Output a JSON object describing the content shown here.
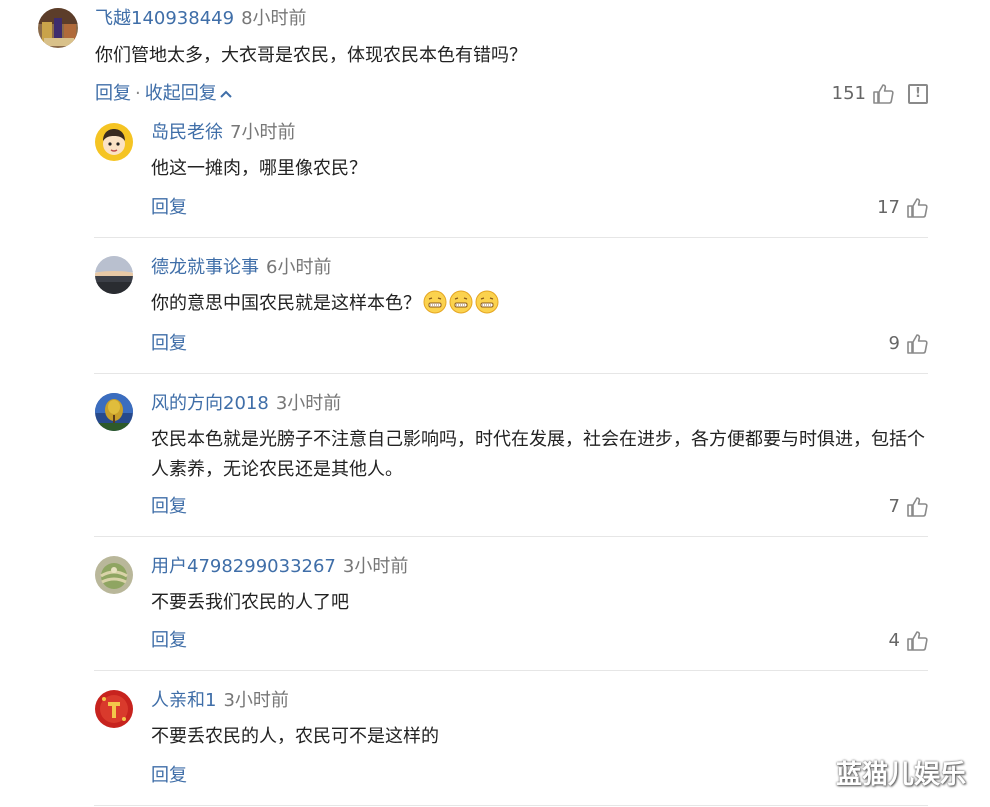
{
  "comments": [
    {
      "username": "飞越140938449",
      "time": "8小时前",
      "text": "你们管地太多，大衣哥是农民，体现农民本色有错吗？",
      "reply_label": "回复",
      "separator": "·",
      "collapse_label": "收起回复",
      "likes": "151"
    },
    {
      "username": "岛民老徐",
      "time": "7小时前",
      "text": "他这一摊肉，哪里像农民？",
      "reply_label": "回复",
      "likes": "17"
    },
    {
      "username": "德龙就事论事",
      "time": "6小时前",
      "text": "你的意思中国农民就是这样本色？",
      "emoji": [
        "zipper-mouth-emoji",
        "zipper-mouth-emoji",
        "zipper-mouth-emoji"
      ],
      "reply_label": "回复",
      "likes": "9"
    },
    {
      "username": "风的方向2018",
      "time": "3小时前",
      "text": "农民本色就是光膀子不注意自己影响吗，时代在发展，社会在进步，各方便都要与时俱进，包括个人素养，无论农民还是其他人。",
      "reply_label": "回复",
      "likes": "7"
    },
    {
      "username": "用户4798299033267",
      "time": "3小时前",
      "text": "不要丢我们农民的人了吧",
      "reply_label": "回复",
      "likes": "4"
    },
    {
      "username": "人亲和1",
      "time": "3小时前",
      "text": "不要丢农民的人，农民可不是这样的",
      "reply_label": "回复"
    }
  ],
  "icons": {
    "like": "thumbs-up-icon",
    "report": "report-icon",
    "collapse": "chevron-up-icon"
  },
  "colors": {
    "username": "#3f6ea8",
    "link": "#3f6ea8",
    "muted": "#777777"
  },
  "watermark": "蓝猫儿娱乐"
}
